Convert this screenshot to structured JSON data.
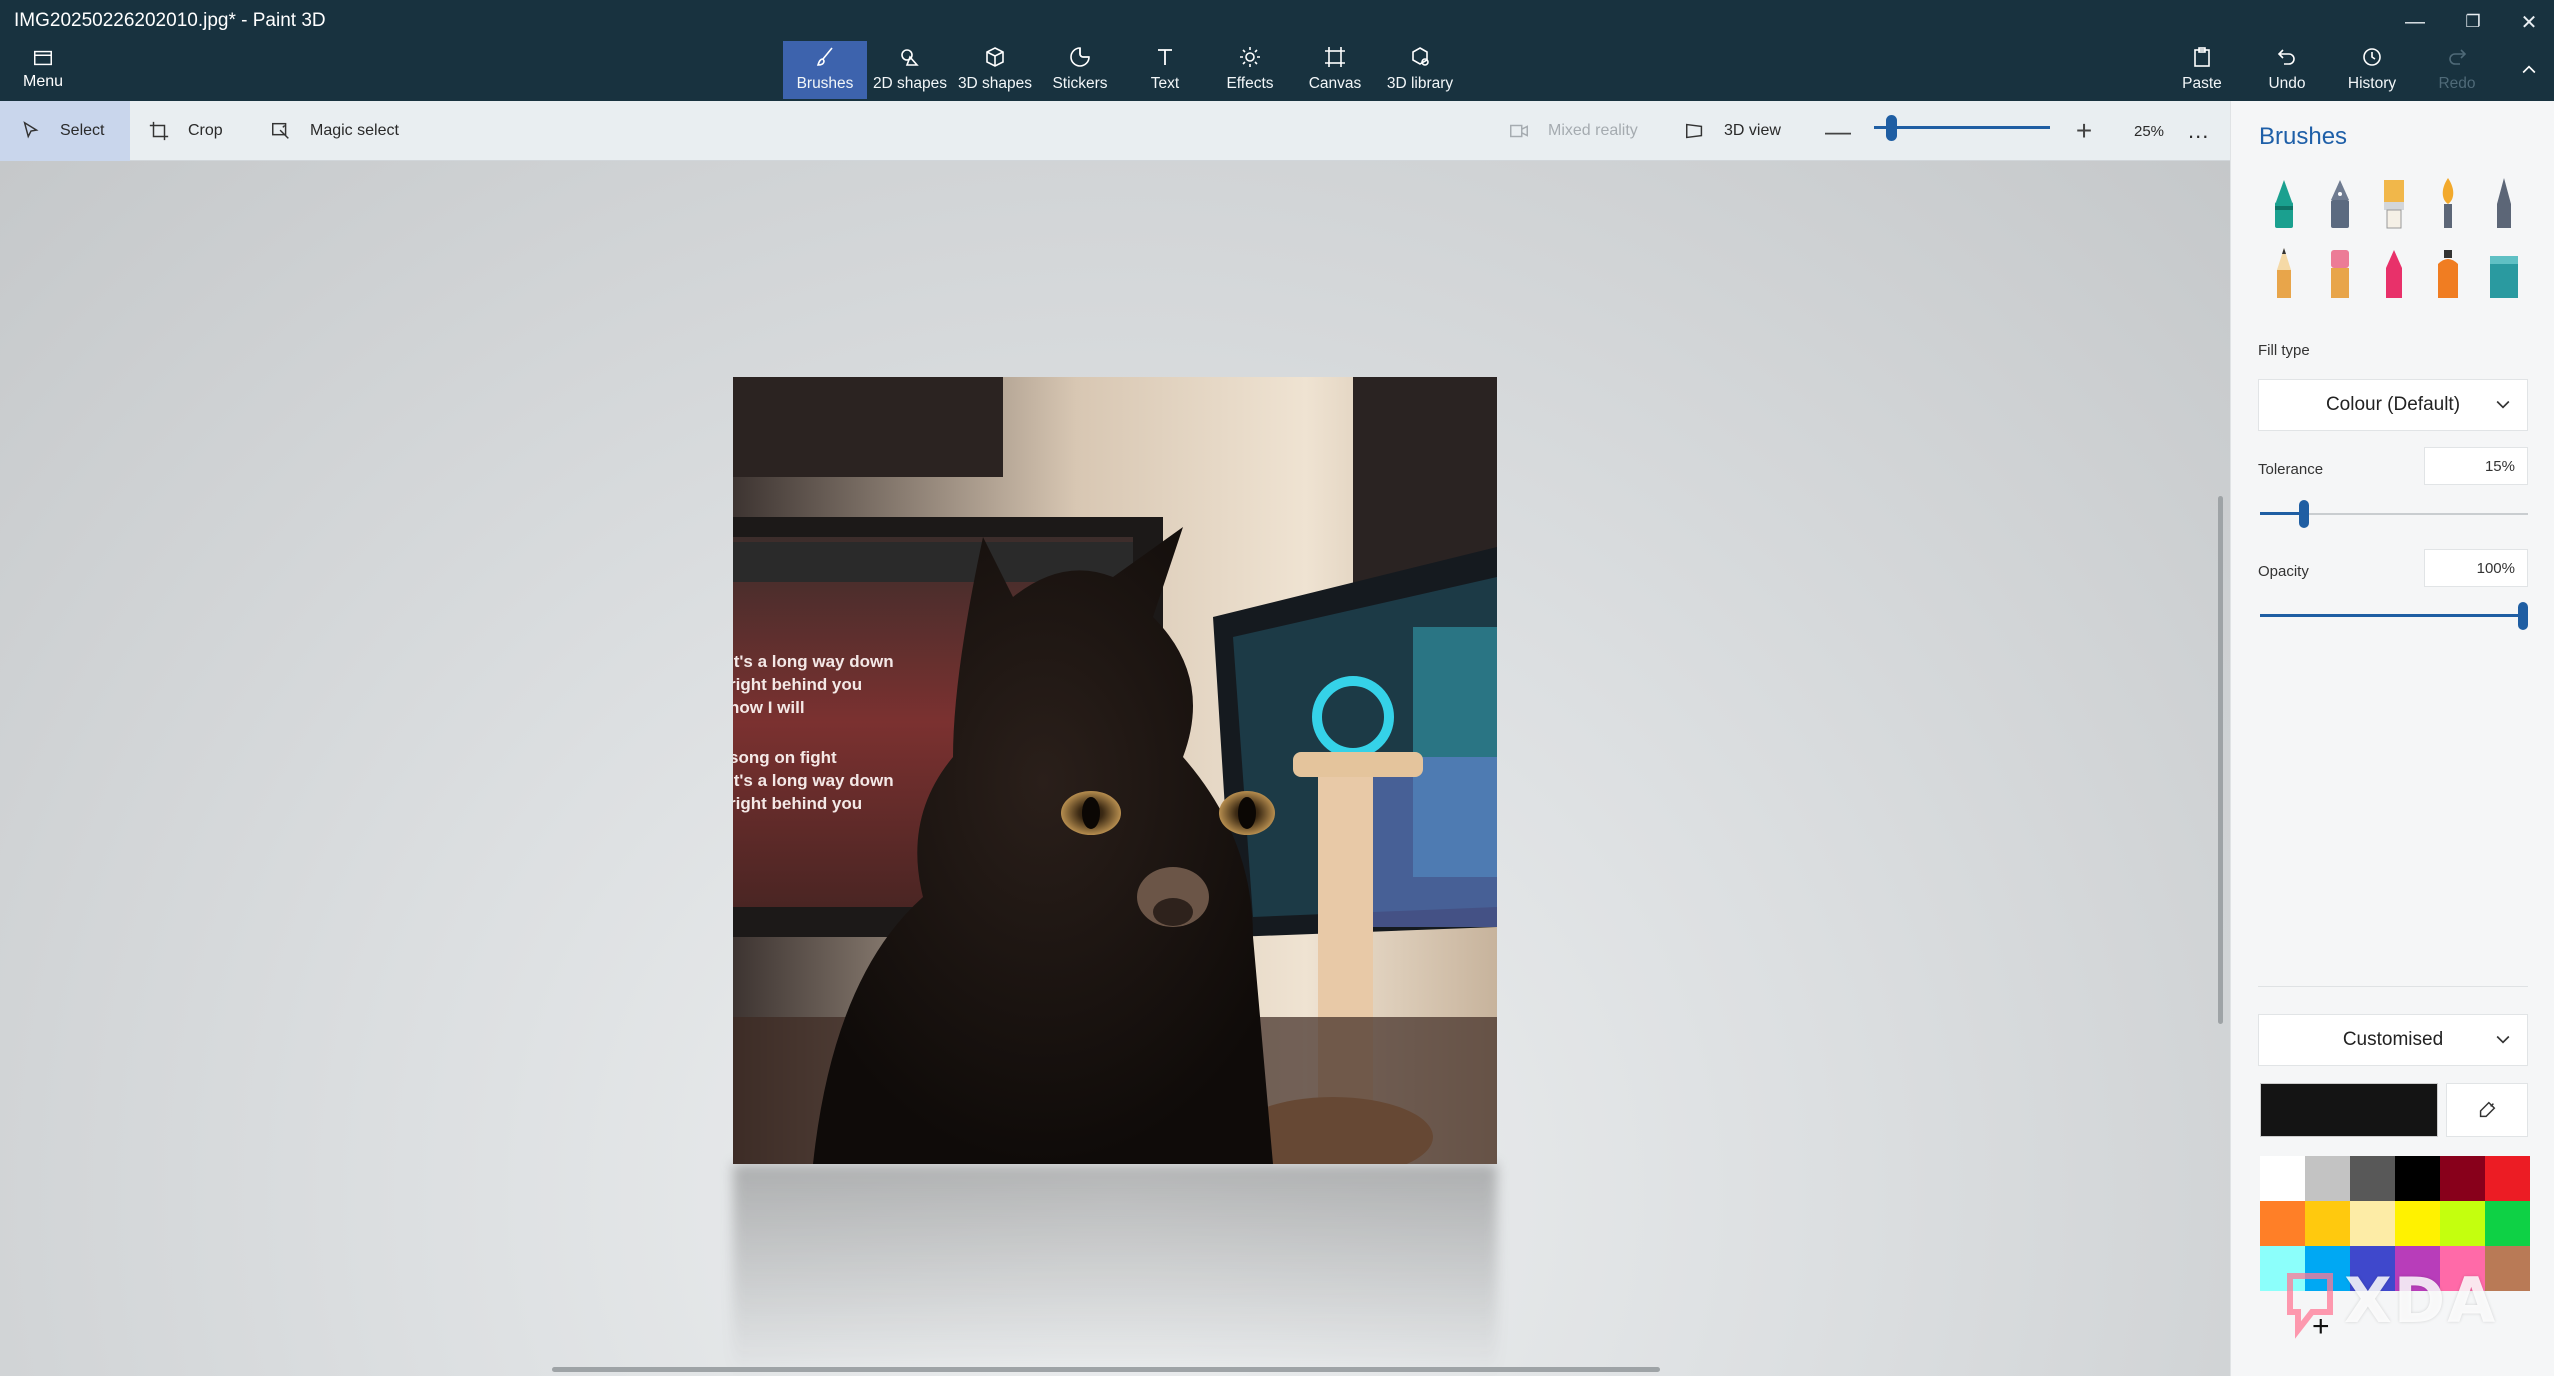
{
  "app": {
    "title": "IMG20250226202010.jpg* - Paint 3D"
  },
  "window_controls": {
    "minimize": "—",
    "restore": "❐",
    "close": "✕"
  },
  "menu": {
    "label": "Menu"
  },
  "tools": [
    {
      "label": "Brushes",
      "icon": "brush-icon",
      "active": true
    },
    {
      "label": "2D shapes",
      "icon": "shapes-2d-icon"
    },
    {
      "label": "3D shapes",
      "icon": "cube-icon"
    },
    {
      "label": "Stickers",
      "icon": "sticker-icon"
    },
    {
      "label": "Text",
      "icon": "text-icon"
    },
    {
      "label": "Effects",
      "icon": "sun-icon"
    },
    {
      "label": "Canvas",
      "icon": "canvas-icon"
    },
    {
      "label": "3D library",
      "icon": "library-icon"
    }
  ],
  "right_actions": {
    "paste": "Paste",
    "undo": "Undo",
    "history": "History",
    "redo": "Redo"
  },
  "subbar": {
    "select": "Select",
    "crop": "Crop",
    "magic_select": "Magic select",
    "mixed_reality": "Mixed reality",
    "view_3d": "3D view",
    "zoom_level": "25%",
    "zoom_fraction": 0.07,
    "more": "..."
  },
  "panel": {
    "title": "Brushes",
    "brushes": [
      {
        "name": "marker",
        "color": "#1aa08f"
      },
      {
        "name": "calligraphy-pen",
        "color": "#5b6a80"
      },
      {
        "name": "oil-brush",
        "color": "#f1b74a"
      },
      {
        "name": "watercolour",
        "color": "#f2a92c"
      },
      {
        "name": "pixel-pen",
        "color": "#5c6677"
      },
      {
        "name": "pencil",
        "color": "#e8a54a"
      },
      {
        "name": "eraser",
        "color": "#ec7b96"
      },
      {
        "name": "crayon",
        "color": "#e8316a"
      },
      {
        "name": "spray-can",
        "color": "#f07d22"
      },
      {
        "name": "fill",
        "color": "#2a9aa0"
      }
    ],
    "fill_type_label": "Fill type",
    "fill_type_value": "Colour (Default)",
    "tolerance_label": "Tolerance",
    "tolerance_value": "15%",
    "tolerance_fraction": 0.15,
    "opacity_label": "Opacity",
    "opacity_value": "100%",
    "opacity_fraction": 1.0,
    "color_mode": "Customised",
    "current_color": "#141414",
    "palette": [
      "#ffffff",
      "#c3c3c3",
      "#585858",
      "#000000",
      "#88001b",
      "#ec1c24",
      "#ff7f27",
      "#ffc90e",
      "#fdeca6",
      "#fff200",
      "#c4ff0e",
      "#0ed145",
      "#8cfffb",
      "#00a8f3",
      "#3f48cc",
      "#b83dba",
      "#ff6aa8",
      "#b97a56"
    ],
    "add_color": "+"
  },
  "photo_text": [
    "It's a long way down",
    "right behind you",
    "now I will",
    "song on fight",
    "it's a long way down",
    "right behind you"
  ],
  "watermark": "XDA"
}
